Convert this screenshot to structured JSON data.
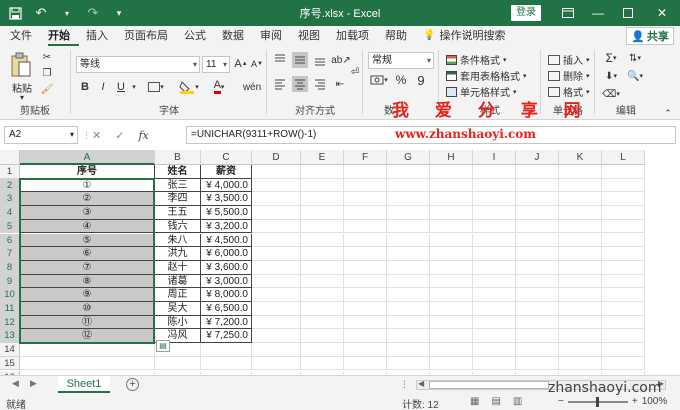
{
  "titlebar": {
    "title": "序号.xlsx  -  Excel",
    "login_label": "登录",
    "save_icon": "save-icon",
    "undo_icon": "undo-icon",
    "redo_icon": "redo-icon"
  },
  "tabs": [
    "文件",
    "开始",
    "插入",
    "页面布局",
    "公式",
    "数据",
    "审阅",
    "视图",
    "加载项",
    "帮助"
  ],
  "active_tab": "开始",
  "search_label": "操作说明搜索",
  "share_label": "共享",
  "ribbon": {
    "clipboard": {
      "paste": "粘贴",
      "label": "剪贴板"
    },
    "font": {
      "name": "等线",
      "size": "11",
      "label": "字体",
      "bold": "B",
      "italic": "I",
      "underline": "U"
    },
    "align": {
      "label": "对齐方式"
    },
    "number": {
      "format": "常规",
      "percent": "%",
      "comma": "9",
      "label": "数"
    },
    "styles": {
      "cond": "条件格式",
      "table": "套用表格格式",
      "cell": "单元格样式",
      "label": "样式"
    },
    "cells": {
      "insert": "插入",
      "delete": "删除",
      "format": "格式",
      "label": "单元格"
    },
    "edit": {
      "label": "编辑"
    }
  },
  "formula_bar": {
    "name_box": "A2",
    "cancel": "✕",
    "enter": "✓",
    "fx": "fx",
    "formula": "=UNICHAR(9311+ROW()-1)"
  },
  "watermark": {
    "title": "我 爱 分 享 网",
    "url": "www.zhanshaoyi.com",
    "footer": "zhanshaoyi.com"
  },
  "columns": [
    "A",
    "B",
    "C",
    "D",
    "E",
    "F",
    "G",
    "H",
    "I",
    "J",
    "K",
    "L"
  ],
  "rows": [
    "1",
    "2",
    "3",
    "4",
    "5",
    "6",
    "7",
    "8",
    "9",
    "10",
    "11",
    "12",
    "13",
    "14",
    "15",
    "16"
  ],
  "table": {
    "headers": [
      "序号",
      "姓名",
      "薪资"
    ],
    "data": [
      [
        "①",
        "张三",
        "¥ 4,000.0"
      ],
      [
        "②",
        "李四",
        "¥ 3,500.0"
      ],
      [
        "③",
        "王五",
        "¥ 5,500.0"
      ],
      [
        "④",
        "钱六",
        "¥ 3,200.0"
      ],
      [
        "⑤",
        "朱八",
        "¥ 4,500.0"
      ],
      [
        "⑥",
        "洪九",
        "¥ 6,000.0"
      ],
      [
        "⑦",
        "赵十",
        "¥ 3,600.0"
      ],
      [
        "⑧",
        "诸葛",
        "¥ 3,000.0"
      ],
      [
        "⑨",
        "周正",
        "¥ 8,000.0"
      ],
      [
        "⑩",
        "吴大",
        "¥ 6,500.0"
      ],
      [
        "⑪",
        "陈小",
        "¥ 7,200.0"
      ],
      [
        "⑫",
        "冯风",
        "¥ 7,250.0"
      ]
    ]
  },
  "sheet_tab": "Sheet1",
  "status": {
    "ready": "就绪",
    "count": "计数: 12",
    "zoom": "100%"
  }
}
